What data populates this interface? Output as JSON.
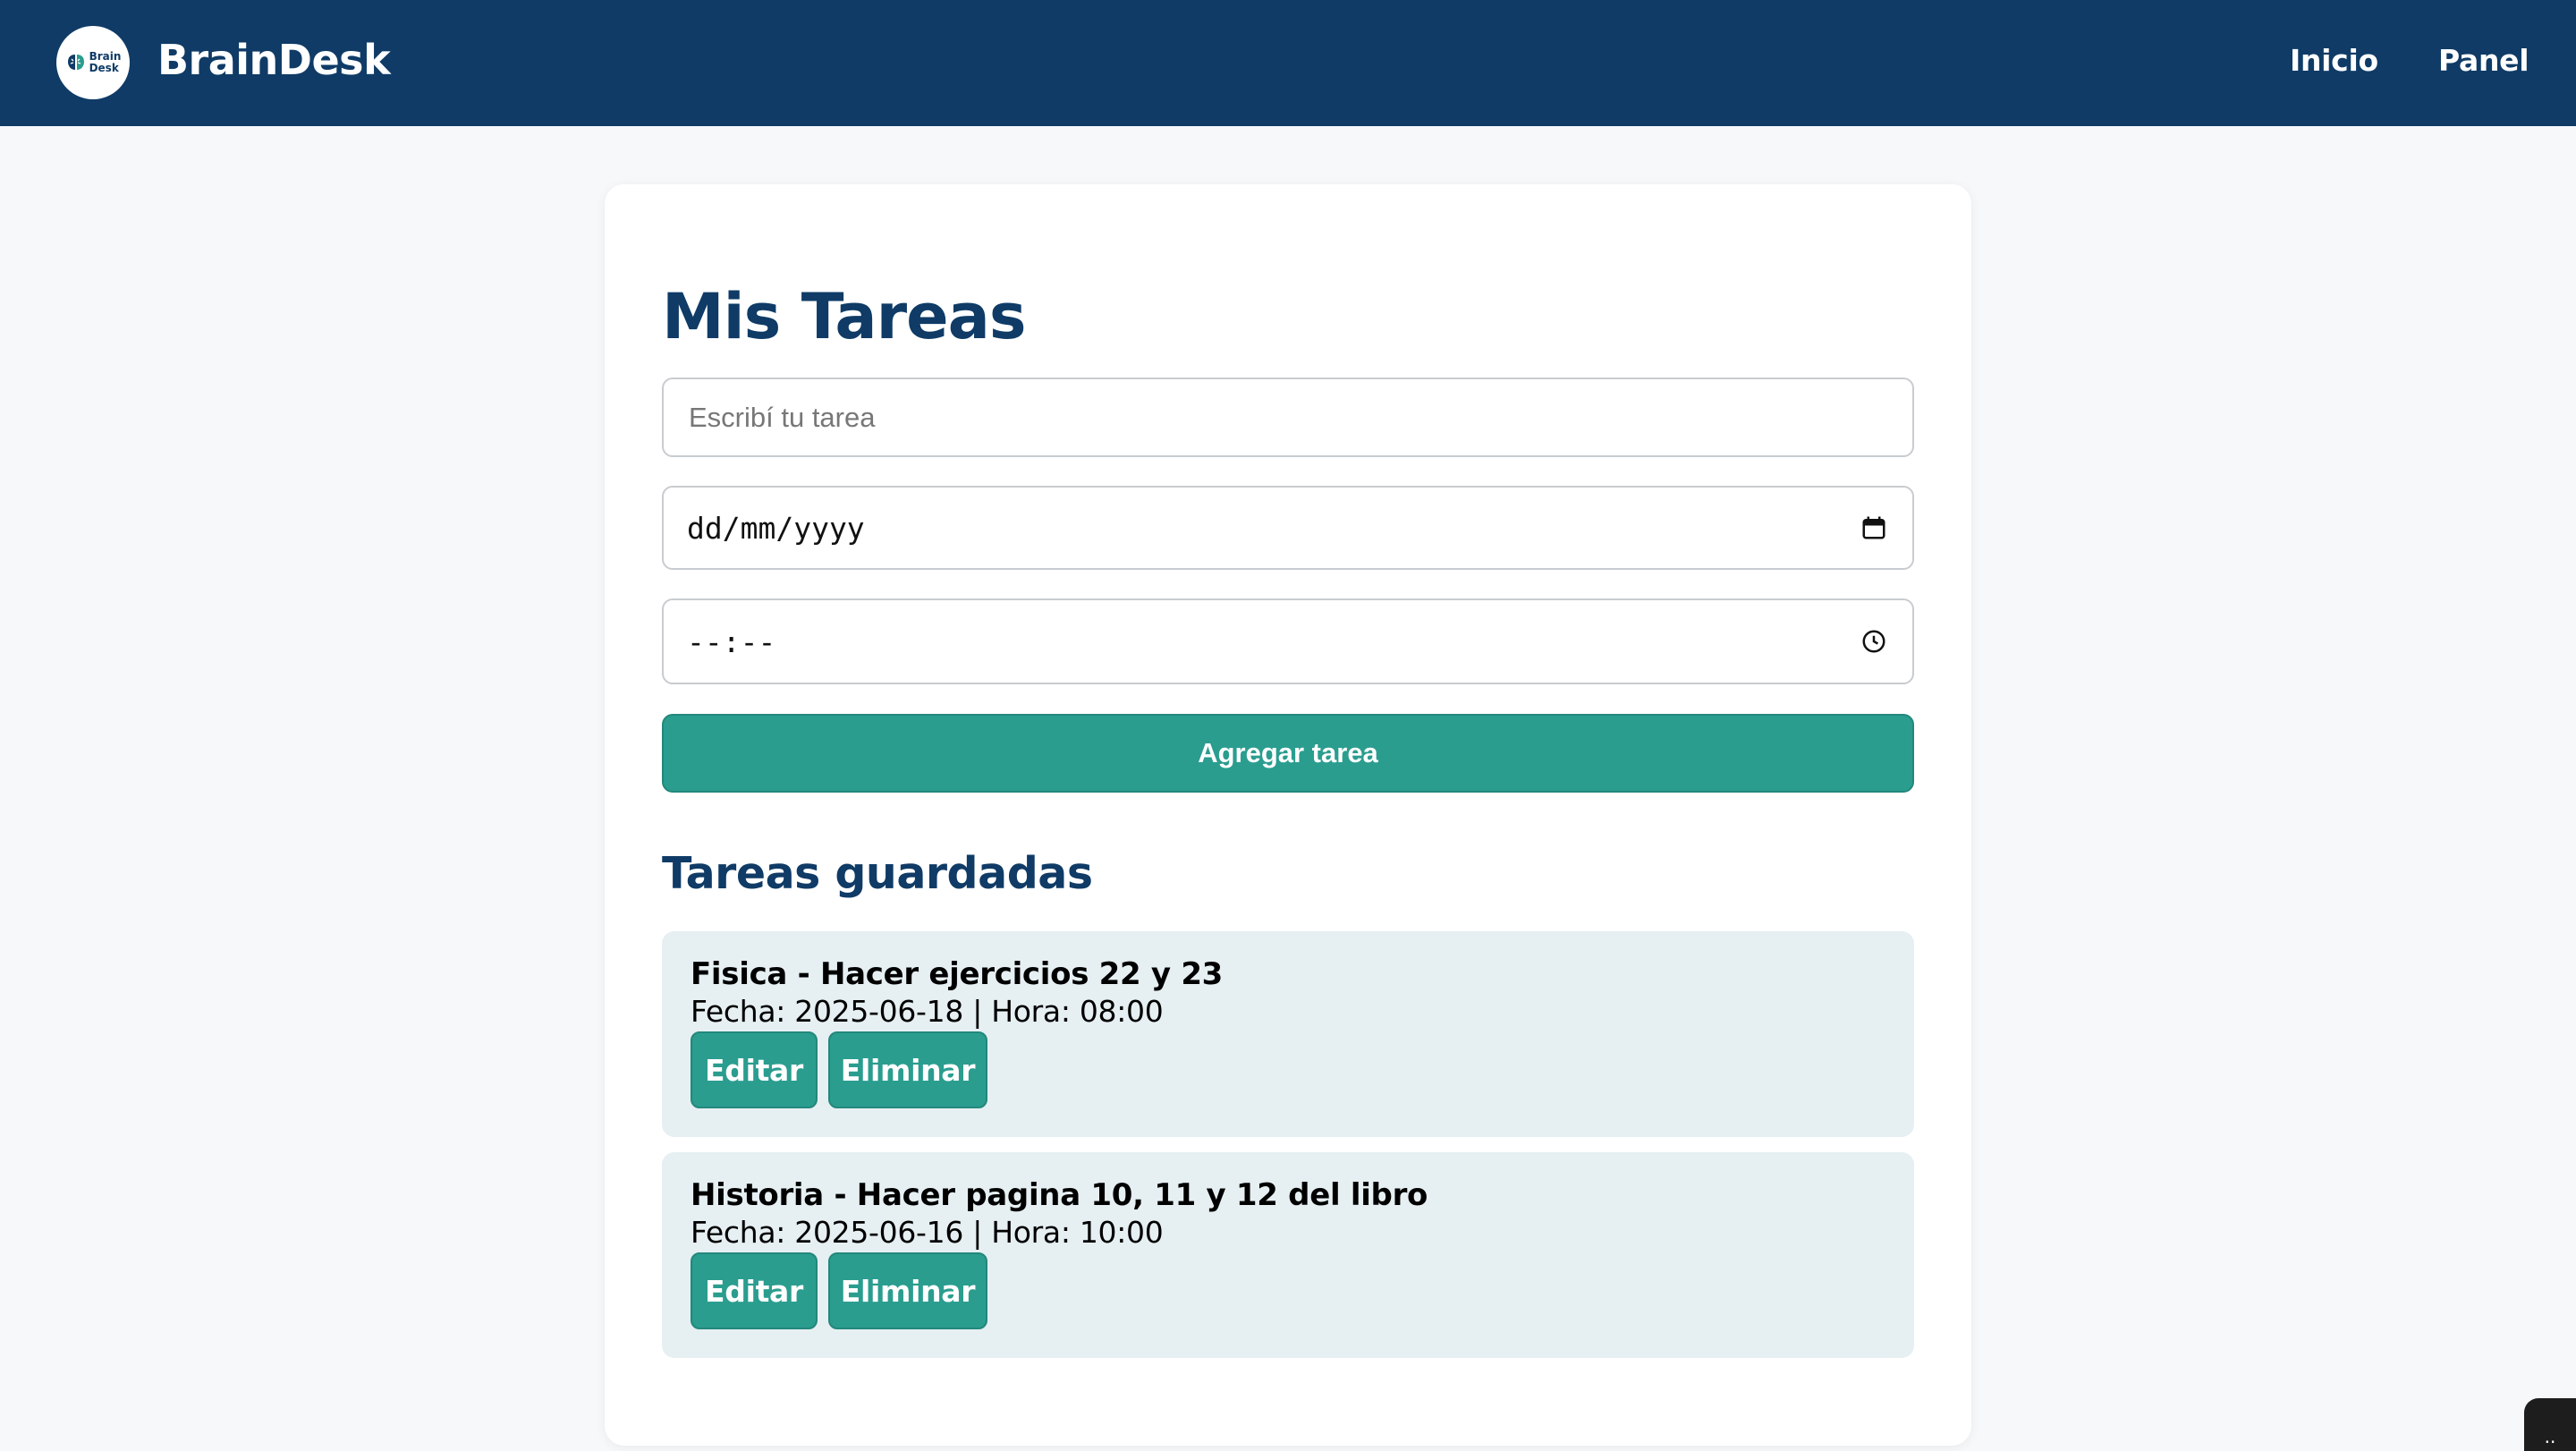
{
  "header": {
    "logo_line1": "Brain",
    "logo_line2": "Desk",
    "brand": "BrainDesk",
    "nav": [
      {
        "label": "Inicio"
      },
      {
        "label": "Panel"
      }
    ]
  },
  "main": {
    "title": "Mis Tareas",
    "form": {
      "task_placeholder": "Escribí tu tarea",
      "task_value": "",
      "date_display": "dd/mm/yyyy",
      "time_display": "--:--",
      "add_label": "Agregar tarea"
    },
    "saved_title": "Tareas guardadas",
    "tasks": [
      {
        "title": "Fisica - Hacer ejercicios 22 y 23",
        "meta": "Fecha: 2025-06-18 | Hora: 08:00",
        "edit_label": "Editar",
        "delete_label": "Eliminar"
      },
      {
        "title": "Historia - Hacer pagina 10, 11 y 12 del libro",
        "meta": "Fecha: 2025-06-16 | Hora: 10:00",
        "edit_label": "Editar",
        "delete_label": "Eliminar"
      }
    ]
  },
  "corner_widget": {
    "label": ".."
  },
  "colors": {
    "header_bg": "#0f3b66",
    "accent": "#2a9d8f",
    "task_bg": "#e6eff2",
    "page_bg": "#f6f8fa"
  },
  "icons": [
    "brain-logo-icon",
    "calendar-icon",
    "clock-icon"
  ]
}
